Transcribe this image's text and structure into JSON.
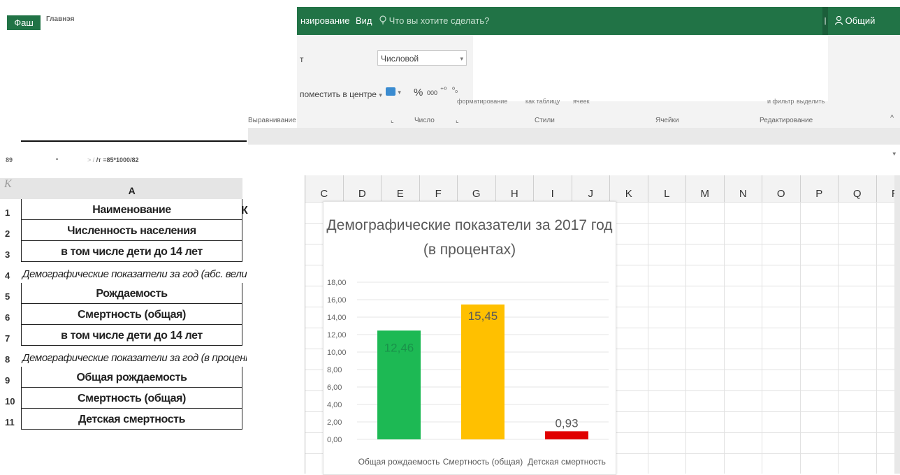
{
  "left_window": {
    "file_tab": "Фаш",
    "home_tab": "Главнэя",
    "formula_bar": {
      "cell_ref": "89",
      "dot": "•",
      "arrow": "> /",
      "formula": "/т =85*1000/82"
    },
    "corner_label": "К",
    "column_header": "A",
    "rows": [
      {
        "num": "1",
        "text": "Наименование",
        "style": "bold"
      },
      {
        "num": "2",
        "text": "Численность населения",
        "style": "bold"
      },
      {
        "num": "3",
        "text": "в том числе дети до 14 лет",
        "style": "bold"
      },
      {
        "num": "4",
        "text": "Демографические показатели за год (абс. величи",
        "style": "italic"
      },
      {
        "num": "5",
        "text": "Рождаемость",
        "style": "bold"
      },
      {
        "num": "6",
        "text": "Смертность (общая)",
        "style": "bold"
      },
      {
        "num": "7",
        "text": "в том числе дети до 14 лет",
        "style": "bold"
      },
      {
        "num": "8",
        "text": "Демографические показатели за год (в процент",
        "style": "italic"
      },
      {
        "num": "9",
        "text": "Общая рождаемость",
        "style": "bold"
      },
      {
        "num": "10",
        "text": "Смертность (общая)",
        "style": "bold"
      },
      {
        "num": "11",
        "text": "Детская смертность",
        "style": "bold"
      }
    ],
    "row1_overflow": "К"
  },
  "right_window": {
    "tabs": [
      "нзирование",
      "Вид"
    ],
    "search_placeholder": "Что вы хотите сделать?",
    "share_label": "Общий доступ",
    "ribbon": {
      "align_char": "т",
      "merge_center": "поместить в центре",
      "number_format": "Числовой",
      "percent_symbol": "%",
      "thousands": "000",
      "cond_fmt_partial": "форматирование",
      "table_fmt_partial": "как таблицу",
      "cell_styles_partial": "ячеек",
      "filter_partial": "и фильтр",
      "select_partial": "выделить"
    },
    "groups": {
      "alignment": "Выравнивание",
      "number": "Число",
      "styles": "Стили",
      "cells": "Ячейки",
      "editing": "Редактирование"
    },
    "columns": [
      "C",
      "D",
      "E",
      "F",
      "G",
      "H",
      "I",
      "J",
      "K",
      "L",
      "M",
      "N",
      "O",
      "P",
      "Q",
      "R"
    ]
  },
  "chart_data": {
    "type": "bar",
    "title": "Демографические показатели за 2017 год (в процентах)",
    "title_line1": "Демографические показатели за 2017 год",
    "title_line2": "(в процентах)",
    "categories": [
      "Общая рождаемость",
      "Смертность (общая)",
      "Детская смертность"
    ],
    "values": [
      12.46,
      15.45,
      0.93
    ],
    "value_labels": [
      "12,46",
      "15,45",
      "0,93"
    ],
    "colors": [
      "#1db954",
      "#ffc000",
      "#e00000"
    ],
    "ylim": [
      0,
      18
    ],
    "y_ticks": [
      "0,00",
      "2,00",
      "4,00",
      "6,00",
      "8,00",
      "10,00",
      "12,00",
      "14,00",
      "16,00",
      "18,00"
    ],
    "grid": true,
    "legend": "none"
  }
}
